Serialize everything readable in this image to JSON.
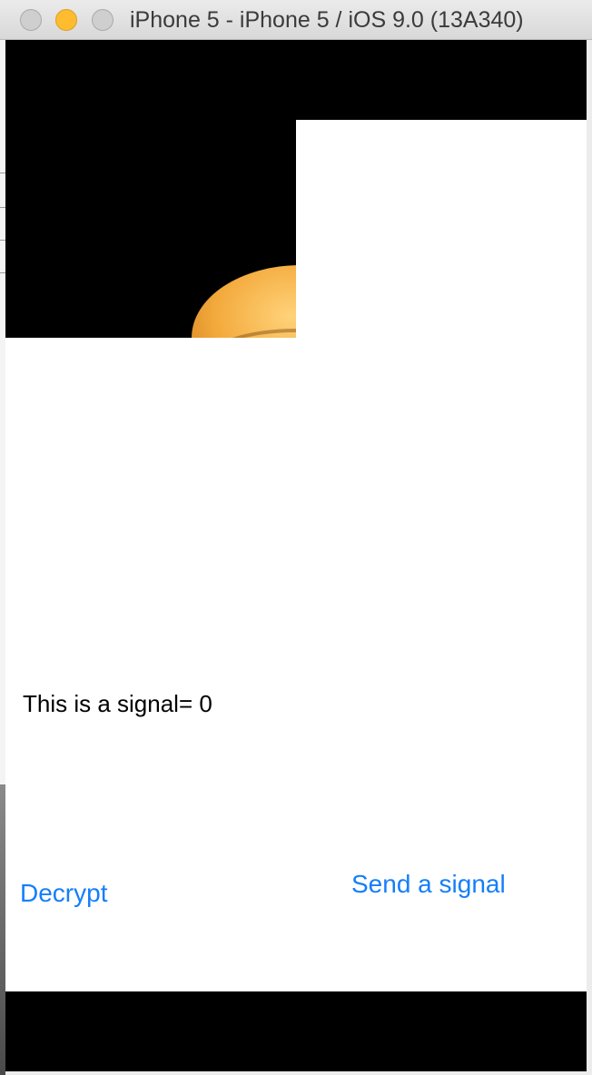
{
  "window": {
    "title": "iPhone 5 - iPhone 5 / iOS 9.0 (13A340)",
    "controls": {
      "close_icon": "close-icon",
      "minimize_icon": "minimize-icon",
      "zoom_icon": "zoom-icon",
      "minimize_color": "#febc2e"
    }
  },
  "app": {
    "signal_text": "This is a signal= 0",
    "decrypt_label": "Decrypt",
    "send_label": "Send a signal",
    "accent_color": "#157efb"
  }
}
